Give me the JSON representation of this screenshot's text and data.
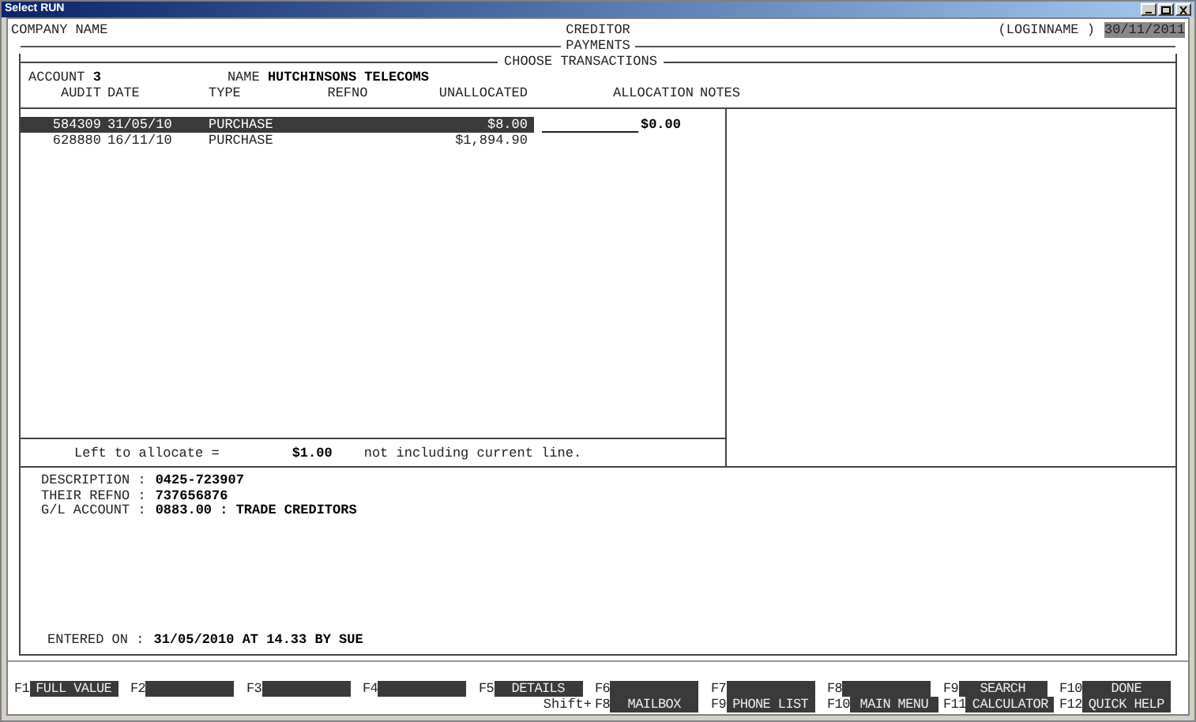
{
  "window": {
    "title": "Select RUN"
  },
  "header": {
    "company": "COMPANY NAME",
    "module": "CREDITOR",
    "login": "(LOGINNAME )",
    "date": "30/11/2011",
    "screen": "PAYMENTS"
  },
  "panel": {
    "title": "CHOOSE TRANSACTIONS",
    "account_label": "ACCOUNT",
    "account": "3",
    "name_label": "NAME",
    "name": "HUTCHINSONS TELECOMS"
  },
  "columns": [
    "AUDIT",
    "DATE",
    "TYPE",
    "REFNO",
    "UNALLOCATED",
    "ALLOCATION",
    "NOTES"
  ],
  "rows": [
    {
      "audit": "584309",
      "date": "31/05/10",
      "type": "PURCHASE",
      "unallocated": "$8.00",
      "allocation": "$0.00",
      "selected": true
    },
    {
      "audit": "628880",
      "date": "16/11/10",
      "type": "PURCHASE",
      "unallocated": "$1,894.90",
      "selected": false
    }
  ],
  "summary": {
    "label": "Left to allocate =",
    "amount": "$1.00",
    "note": "not including current line."
  },
  "details": [
    {
      "label": "DESCRIPTION :",
      "value": "0425-723907"
    },
    {
      "label": "THEIR REFNO :",
      "value": "737656876"
    },
    {
      "label": "G/L ACCOUNT :",
      "value": "0883.00 : TRADE CREDITORS"
    }
  ],
  "entered": {
    "label": "ENTERED ON :",
    "value": "31/05/2010 AT 14.33 BY SUE"
  },
  "function_keys": [
    {
      "key": "F1",
      "label": "FULL VALUE"
    },
    {
      "key": "F2"
    },
    {
      "key": "F3"
    },
    {
      "key": "F4"
    },
    {
      "key": "F5",
      "label": "DETAILS"
    },
    {
      "key": "F6"
    },
    {
      "key": "F7"
    },
    {
      "key": "F8"
    },
    {
      "key": "F9",
      "label": "SEARCH"
    },
    {
      "key": "F10",
      "label": "DONE"
    }
  ],
  "shift_label": "Shift+",
  "shift_keys": [
    {
      "key": "F8",
      "label": "MAILBOX"
    },
    {
      "key": "F9",
      "label": "PHONE LIST"
    },
    {
      "key": "F10",
      "label": "MAIN MENU"
    },
    {
      "key": "F11",
      "label": "CALCULATOR"
    },
    {
      "key": "F12",
      "label": "QUICK HELP"
    }
  ]
}
